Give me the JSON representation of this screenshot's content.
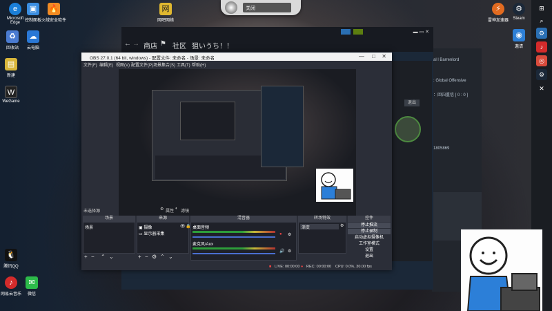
{
  "desktop_icons": [
    {
      "label": "Microsoft Edge",
      "icon": "edge-icon",
      "color": "#1b7fd8"
    },
    {
      "label": "回收站",
      "icon": "recycle-bin-icon",
      "color": "#4a7bd1"
    },
    {
      "label": "新建",
      "icon": "folder-icon",
      "color": "#d8b63a"
    },
    {
      "label": "WeGame",
      "icon": "wegame-icon",
      "color": "#222222"
    },
    {
      "label": "控制面板",
      "icon": "control-panel-icon",
      "color": "#3a8de0"
    },
    {
      "label": "火绒安全软件",
      "icon": "huorong-icon",
      "color": "#f08a24"
    },
    {
      "label": "云电脑",
      "icon": "cloud-pc-icon",
      "color": "#2a78d6"
    },
    {
      "label": "网易云音乐",
      "icon": "netease-music-icon",
      "color": "#d42b2b"
    },
    {
      "label": "腾讯QQ",
      "icon": "qq-icon",
      "color": "#111111"
    },
    {
      "label": "微信",
      "icon": "wechat-icon",
      "color": "#2dbb4a"
    },
    {
      "label": "网吧网络",
      "icon": "netcafe-icon",
      "color": "#e0b830"
    },
    {
      "label": "雷神加速器",
      "icon": "leishen-icon",
      "color": "#e26b20"
    },
    {
      "label": "Steam",
      "icon": "steam-icon",
      "color": "#1b2838"
    },
    {
      "label": "邀请",
      "icon": "invite-icon",
      "color": "#2d7fd6"
    }
  ],
  "volume_popup": {
    "label": "关闭"
  },
  "steam": {
    "nav": [
      "商店",
      "社区",
      "狙いうち！！"
    ],
    "side_lines": [
      "al l Barrenlord",
      ": Global Offensive",
      "：回归重信 [ 0 : 0 ]",
      "退出",
      "...",
      "1805869",
      "...",
      "...",
      "...",
      "...",
      "退出(Alt)",
      "两个 Fire"
    ],
    "chat_buttons": [
      "退出",
      "..."
    ]
  },
  "obs": {
    "title": "OBS 27.0.1 (64 bit, windows) - 配置文件: 未命名 - 场景: 未命名",
    "menu": [
      "文件(F)",
      "编辑(E)",
      "视图(V)",
      "配置文件(P)",
      "场景集合(S)",
      "工具(T)",
      "帮助(H)"
    ],
    "selected_hint": "未选择源",
    "props_btn": "属性",
    "filters_btn": "滤镜",
    "docks": {
      "scenes": {
        "title": "场景",
        "items": [
          "场景"
        ]
      },
      "sources": {
        "title": "来源",
        "items": [
          "摄像",
          "显示器采集"
        ]
      },
      "mixer": {
        "title": "混音器",
        "tracks": [
          "桌面音频",
          "麦克风/Aux"
        ]
      },
      "transitions": {
        "title": "转场特效",
        "selected": "渐变"
      },
      "controls": {
        "title": "控件",
        "buttons": [
          "停止推流",
          "停止录制",
          "启动虚拟摄像机",
          "工作室模式",
          "设置",
          "退出"
        ]
      }
    },
    "statusbar": {
      "live": "LIVE: 00:00:00",
      "rec": "REC: 00:00:00",
      "cpu": "CPU: 0.0%, 30.00 fps"
    }
  }
}
